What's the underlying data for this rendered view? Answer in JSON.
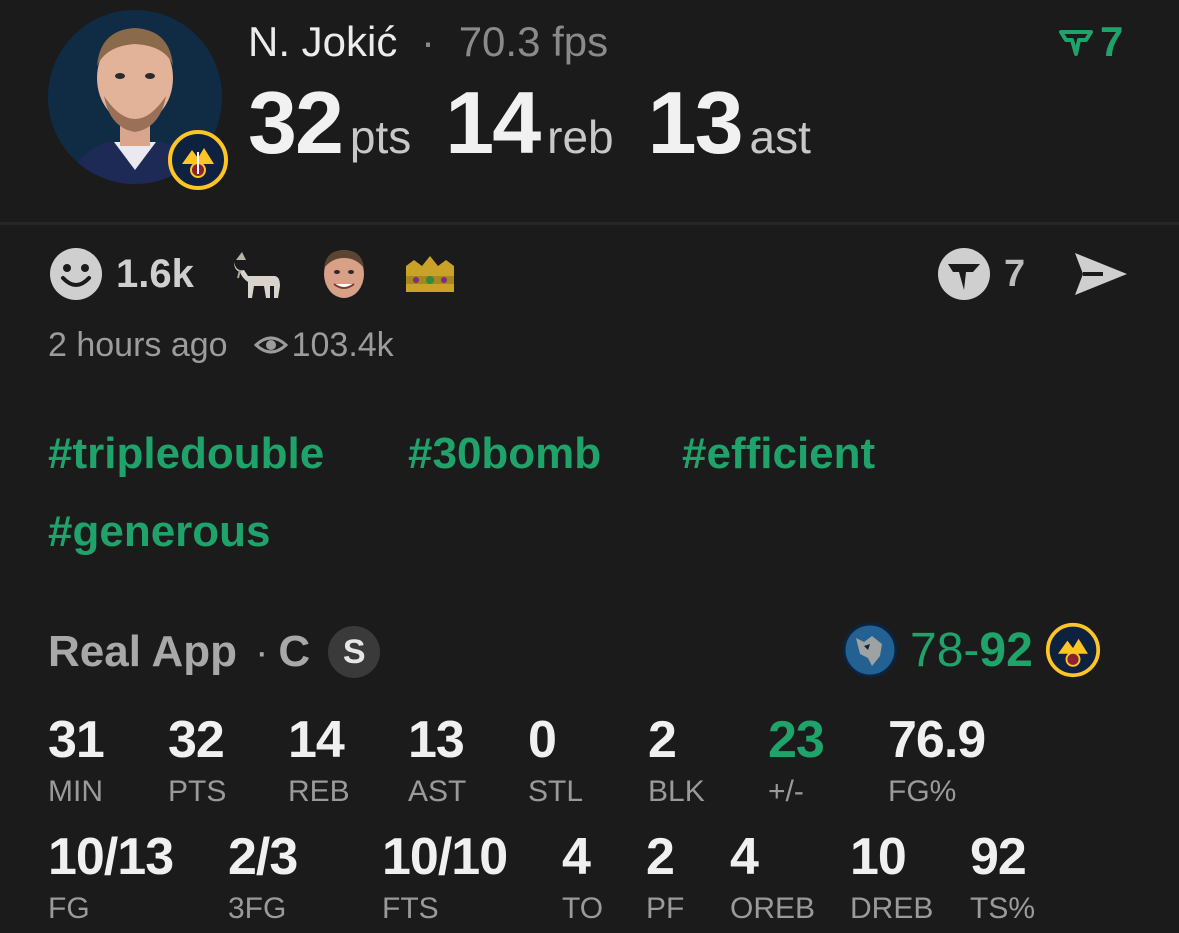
{
  "player": {
    "name": "N. Jokić",
    "separator": "·",
    "fps": "70.3 fps"
  },
  "headline_stats": [
    {
      "value": "32",
      "unit": "pts"
    },
    {
      "value": "14",
      "unit": "reb"
    },
    {
      "value": "13",
      "unit": "ast"
    }
  ],
  "top_vote": {
    "count": "7",
    "icon": "vote-check-icon"
  },
  "reactions": {
    "count": "1.6k",
    "icons": [
      "smiley-face-icon",
      "goat-emoji",
      "player-face-emoji",
      "crown-emoji"
    ]
  },
  "share": {
    "count": "7",
    "icons": [
      "vote-shield-icon",
      "send-icon"
    ]
  },
  "meta": {
    "time": "2 hours ago",
    "views": "103.4k"
  },
  "hashtags": [
    "#tripledouble",
    "#30bomb",
    "#efficient",
    "#generous"
  ],
  "source": {
    "name": "Real App",
    "separator": "·",
    "position": "C",
    "badge": "S"
  },
  "game": {
    "away_score": "78",
    "dash": "-",
    "home_score": "92",
    "away_team_icon": "timberwolves-logo",
    "home_team_icon": "nuggets-logo"
  },
  "stats_row1": [
    {
      "value": "31",
      "label": "MIN"
    },
    {
      "value": "32",
      "label": "PTS"
    },
    {
      "value": "14",
      "label": "REB"
    },
    {
      "value": "13",
      "label": "AST"
    },
    {
      "value": "0",
      "label": "STL"
    },
    {
      "value": "2",
      "label": "BLK"
    },
    {
      "value": "23",
      "label": "+/-"
    },
    {
      "value": "76.9",
      "label": "FG%"
    }
  ],
  "stats_row2": [
    {
      "value": "10/13",
      "label": "FG"
    },
    {
      "value": "2/3",
      "label": "3FG"
    },
    {
      "value": "10/10",
      "label": "FTS"
    },
    {
      "value": "4",
      "label": "TO"
    },
    {
      "value": "2",
      "label": "PF"
    },
    {
      "value": "4",
      "label": "OREB"
    },
    {
      "value": "10",
      "label": "DREB"
    },
    {
      "value": "92",
      "label": "TS%"
    }
  ],
  "colors": {
    "accent": "#1fa36a",
    "background": "#1b1b1b"
  }
}
